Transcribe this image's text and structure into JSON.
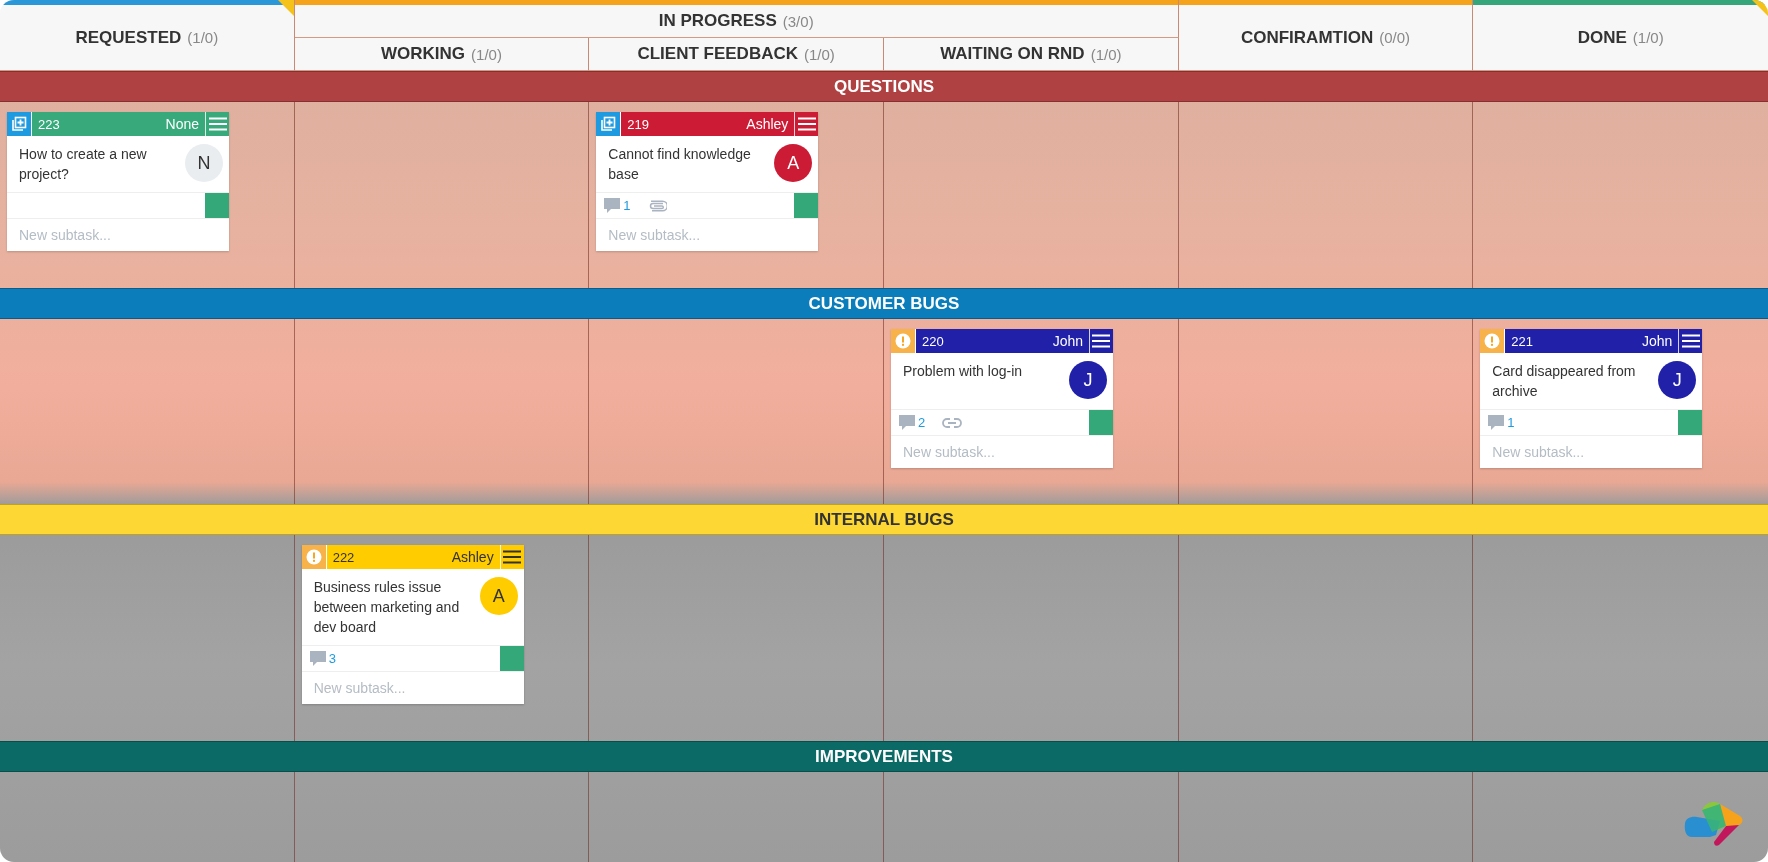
{
  "columns": [
    {
      "title": "REQUESTED",
      "count": "(1/0)",
      "color": "#2a98d8",
      "corner_mark": true
    },
    {
      "title": "IN PROGRESS",
      "count": "(3/0)",
      "color": "#f5a31a",
      "corner_mark": false,
      "children": [
        {
          "title": "WORKING",
          "count": "(1/0)"
        },
        {
          "title": "CLIENT FEEDBACK",
          "count": "(1/0)"
        },
        {
          "title": "WAITING ON RND",
          "count": "(1/0)"
        }
      ]
    },
    {
      "title": "CONFIRAMTION",
      "count": "(0/0)",
      "color": "#f5a31a",
      "corner_mark": false
    },
    {
      "title": "DONE",
      "count": "(1/0)",
      "color": "#35a57a",
      "corner_mark": true
    }
  ],
  "lanes": [
    {
      "title": "QUESTIONS",
      "color": "#b04142",
      "cells": [
        {
          "cards": [
            {
              "kind": "add",
              "number": "223",
              "assignee": "None",
              "color": "#37a97b",
              "title": "How to create a new project?",
              "avatar": {
                "letter": "N",
                "color": "#e9edf0"
              },
              "attachment": false,
              "link": false,
              "subtask_placeholder": "New subtask..."
            }
          ]
        },
        {},
        {
          "cards": [
            {
              "kind": "add",
              "number": "219",
              "assignee": "Ashley",
              "color": "#cc1c35",
              "title": "Cannot find knowledge base",
              "avatar": {
                "letter": "A",
                "color": "#cc1c35"
              },
              "comments": "1",
              "attachment": true,
              "link": false,
              "subtask_placeholder": "New subtask..."
            }
          ]
        },
        {},
        {},
        {}
      ]
    },
    {
      "title": "CUSTOMER BUGS",
      "color": "#0b7dbb",
      "cells": [
        {},
        {},
        {},
        {
          "cards": [
            {
              "kind": "alert",
              "number": "220",
              "assignee": "John",
              "color": "#2020a8",
              "title": "Problem with log-in",
              "avatar": {
                "letter": "J",
                "color": "#2020a8"
              },
              "comments": "2",
              "attachment": false,
              "link": true,
              "subtask_placeholder": "New subtask..."
            }
          ]
        },
        {},
        {
          "cards": [
            {
              "kind": "alert",
              "number": "221",
              "assignee": "John",
              "color": "#2020a8",
              "title": "Card disappeared from archive",
              "avatar": {
                "letter": "J",
                "color": "#2020a8"
              },
              "comments": "1",
              "attachment": false,
              "link": false,
              "subtask_placeholder": "New subtask..."
            }
          ]
        }
      ]
    },
    {
      "title": "INTERNAL BUGS",
      "color": "#fdd835",
      "cells": [
        {},
        {
          "cards": [
            {
              "kind": "alert",
              "number": "222",
              "assignee": "Ashley",
              "color": "#ffcc00",
              "title": "Business rules issue between marketing and dev board",
              "avatar": {
                "letter": "A",
                "color": "#ffcc00"
              },
              "comments": "3",
              "attachment": false,
              "link": false,
              "subtask_placeholder": "New subtask..."
            }
          ]
        },
        {},
        {},
        {},
        {}
      ]
    },
    {
      "title": "IMPROVEMENTS",
      "color": "#0b6a66"
    }
  ]
}
